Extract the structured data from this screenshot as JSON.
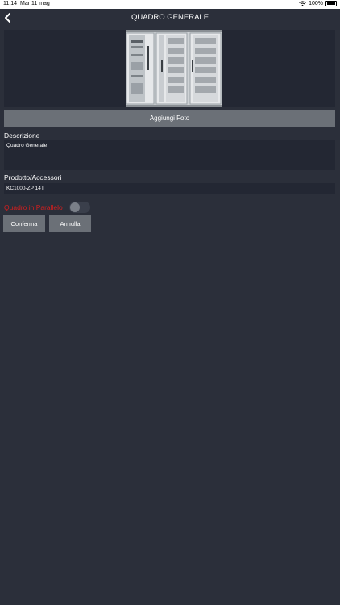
{
  "status_bar": {
    "time": "11:14",
    "date": "Mar 11 mag",
    "battery": "100%"
  },
  "header": {
    "title": "QUADRO GENERALE",
    "back_icon": "chevron-left-icon"
  },
  "photo": {
    "add_label": "Aggiungi Foto"
  },
  "form": {
    "description_label": "Descrizione",
    "description_value": "Quadro Generale",
    "product_label": "Prodotto/Accessori",
    "product_value": "KC1000-ZP 14T",
    "parallel_label": "Quadro in Parallelo",
    "parallel_on": false
  },
  "actions": {
    "confirm_label": "Conferma",
    "cancel_label": "Annulla"
  },
  "colors": {
    "background": "#2b2f3a",
    "field": "#232733",
    "button": "#6b7077",
    "alert": "#d11f1f"
  }
}
